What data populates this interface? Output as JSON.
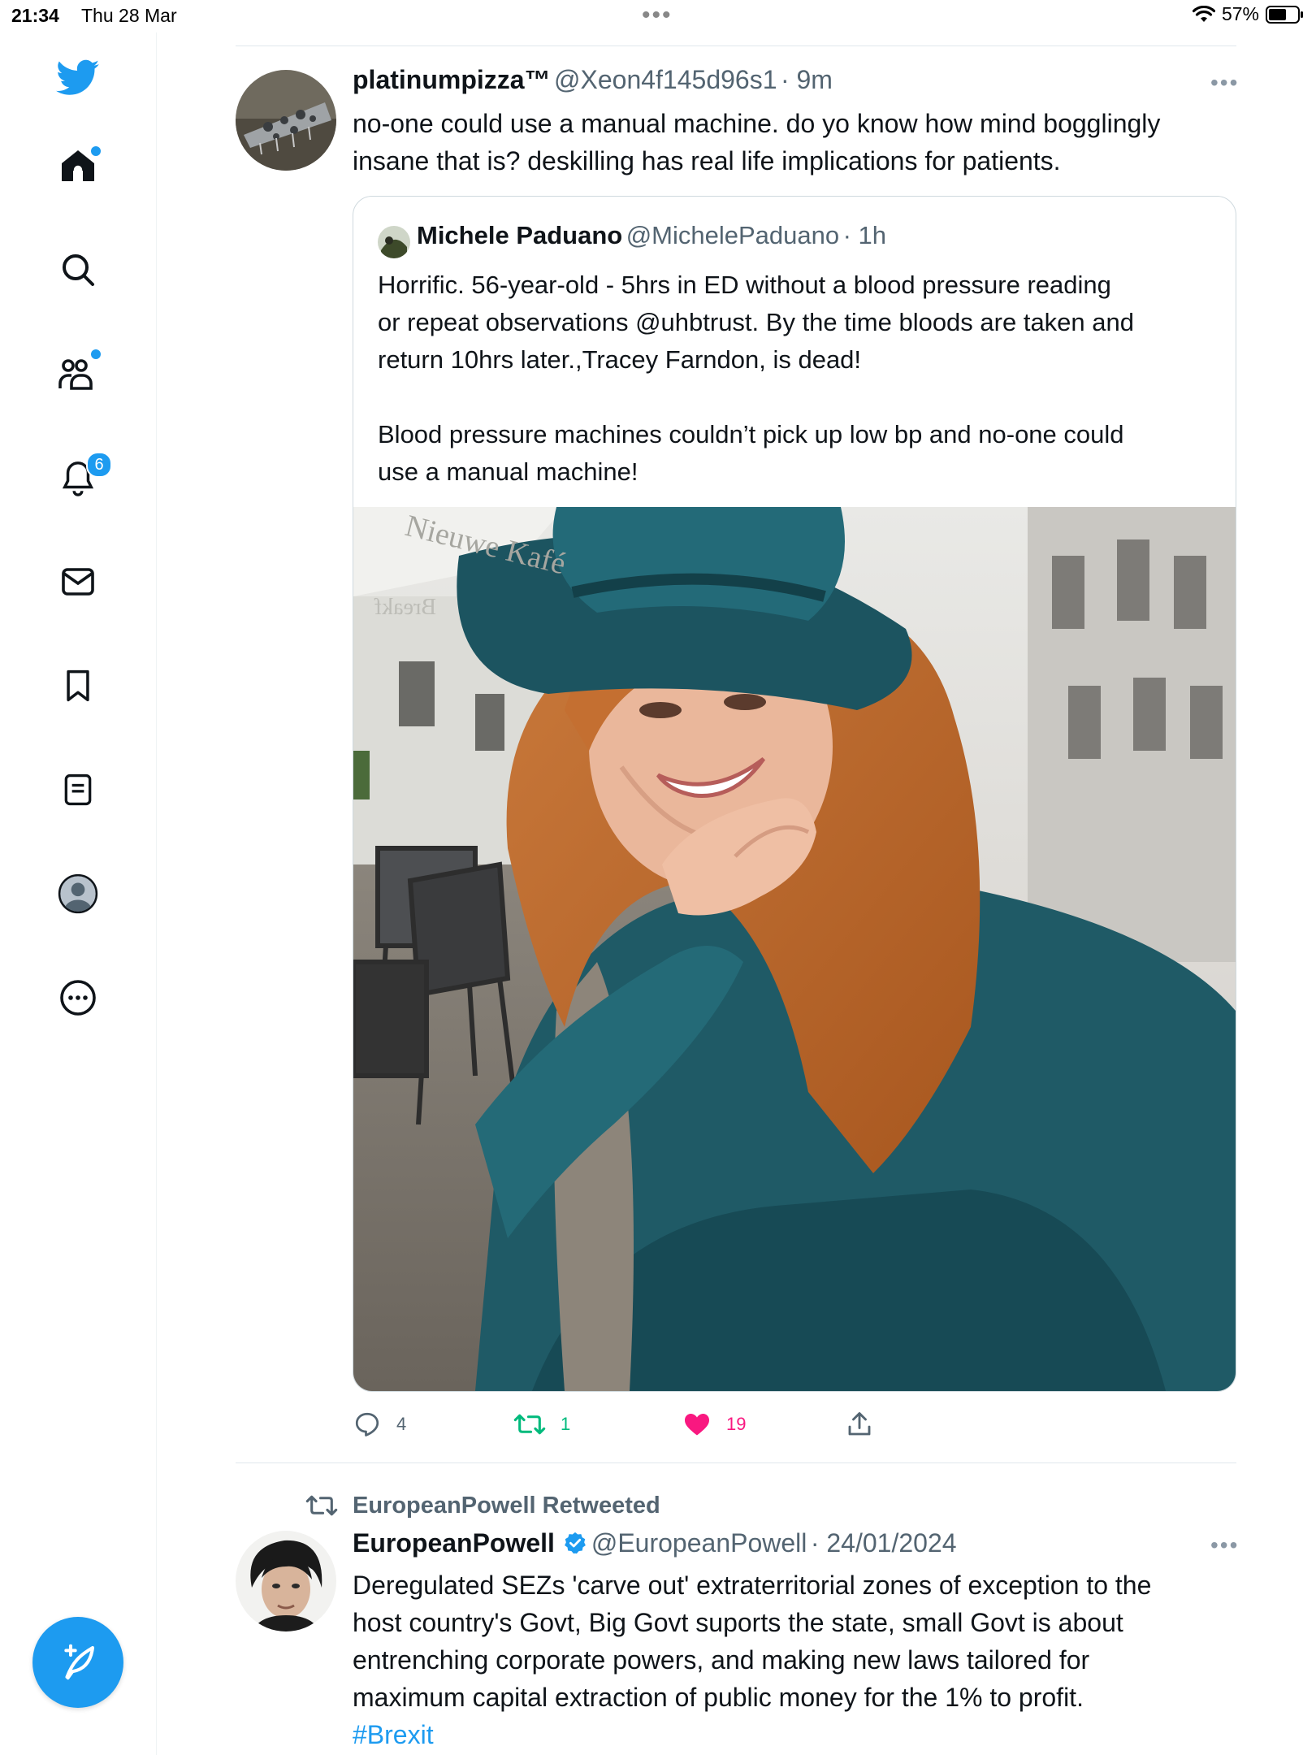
{
  "status_bar": {
    "time": "21:34",
    "date": "Thu 28 Mar",
    "battery": "57%"
  },
  "sidebar": {
    "items": [
      {
        "name": "twitter-logo-icon"
      },
      {
        "name": "home-icon"
      },
      {
        "name": "search-icon"
      },
      {
        "name": "communities-icon"
      },
      {
        "name": "notifications-icon",
        "badge": "6"
      },
      {
        "name": "messages-icon"
      },
      {
        "name": "bookmarks-icon"
      },
      {
        "name": "lists-icon"
      },
      {
        "name": "profile-icon"
      },
      {
        "name": "more-icon"
      }
    ],
    "compose_icon": "compose-tweet-icon",
    "accent": "#1d9bf0"
  },
  "tweet1": {
    "display_name": "platinumpizza™",
    "handle": "@Xeon4f145d96s1",
    "time": "· 9m",
    "text_line1": "no-one could use a manual machine. do yo know how mind bogglingly",
    "text_line2": "insane that is? deskilling has real life implications for patients.",
    "quote": {
      "display_name": "Michele Paduano",
      "handle": "@MichelePaduano",
      "time": "· 1h",
      "para1_line1": "Horrific. 56-year-old  - 5hrs  in ED without a blood pressure reading",
      "para1_line2": "or repeat observations @uhbtrust. By the time bloods are taken and",
      "para1_line3": "return 10hrs later.,Tracey Farndon, is  dead!",
      "para2_line1": "Blood pressure machines couldn’t pick up low bp and no-one could",
      "para2_line2": "use a manual machine!",
      "photo_sign_text": "Nieuwe Kafé",
      "photo_sign_text2": "Breakf"
    },
    "actions": {
      "replies": "4",
      "retweets": "1",
      "likes": "19"
    },
    "colors": {
      "retweet": "#00ba7c",
      "like": "#f91880"
    }
  },
  "tweet2": {
    "retweeted_by": "EuropeanPowell Retweeted",
    "display_name": "EuropeanPowell",
    "handle": "@EuropeanPowell",
    "time": "· 24/01/2024",
    "text_line1": "Deregulated SEZs 'carve out' extraterritorial zones of exception to the",
    "text_line2": "host country's Govt, Big Govt suports the state, small Govt is about",
    "text_line3": "entrenching corporate powers, and making new laws tailored for",
    "text_line4": "maximum capital extraction of public money for the 1% to profit.",
    "hashtag": "#Brexit"
  }
}
